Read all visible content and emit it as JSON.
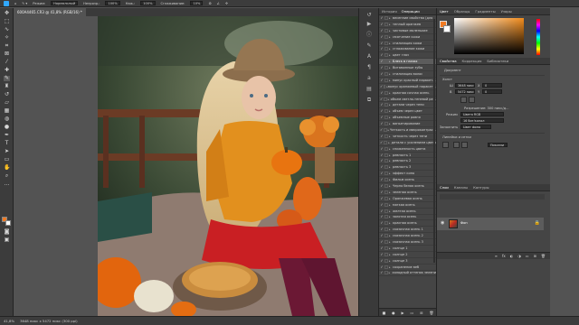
{
  "options_bar": {
    "mode_label": "Режим:",
    "mode_value": "Нормальный",
    "opacity_label": "Непрозр.:",
    "opacity_value": "100%",
    "pressure_label": "Наж.:",
    "pressure_value": "100%",
    "smoothing_label": "Сглаживание:",
    "smoothing_value": "10%"
  },
  "document_tab": {
    "title": "600A4465.CR3 @ 41,8% (RGB/16) *"
  },
  "status_bar": {
    "zoom": "41,8%",
    "dimensions": "3648 пикс x 5472 пикс (300 ppi)"
  },
  "actions_panel": {
    "tabs": [
      "История",
      "Операции"
    ],
    "active_tab": "Операции",
    "items": [
      {
        "label": "весенние свойства (для",
        "checked": true,
        "selected": false
      },
      {
        "label": "теплый оранжев",
        "checked": true,
        "selected": false
      },
      {
        "label": "чистовые маленькие",
        "checked": true,
        "selected": false
      },
      {
        "label": "смягчение кожи",
        "checked": true,
        "selected": false
      },
      {
        "label": "стилизация кожи",
        "checked": true,
        "selected": false
      },
      {
        "label": "сглаживание кожи",
        "checked": true,
        "selected": false
      },
      {
        "label": "цвет глаз",
        "checked": true,
        "selected": false
      },
      {
        "label": "Блеск в глазах",
        "checked": true,
        "selected": true
      },
      {
        "label": "Витаминные зубы",
        "checked": true,
        "selected": false
      },
      {
        "label": "стилизация волос",
        "checked": true,
        "selected": false
      },
      {
        "label": "минус красный паракет...",
        "checked": true,
        "selected": false
      },
      {
        "label": "минус оранжевый паракет...",
        "checked": true,
        "selected": false
      },
      {
        "label": "красная сочная осень",
        "checked": true,
        "selected": false
      },
      {
        "label": "объем светло-теневой ре...",
        "checked": true,
        "selected": false
      },
      {
        "label": "детали через тени",
        "checked": true,
        "selected": false
      },
      {
        "label": "объем через цвет",
        "checked": true,
        "selected": false
      },
      {
        "label": "объемные ровня",
        "checked": true,
        "selected": false
      },
      {
        "label": "виньетирование",
        "checked": true,
        "selected": false
      },
      {
        "label": "Четкость и микроконтрас...",
        "checked": true,
        "selected": false
      },
      {
        "label": "четкость через тени",
        "checked": true,
        "selected": false
      },
      {
        "label": "детали с усилением цвета",
        "checked": true,
        "selected": false
      },
      {
        "label": "сниженность цвета",
        "checked": true,
        "selected": false
      },
      {
        "label": "ревность 1",
        "checked": true,
        "selected": false
      },
      {
        "label": "ревность 2",
        "checked": true,
        "selected": false
      },
      {
        "label": "ревность 3",
        "checked": true,
        "selected": false
      },
      {
        "label": "эффект кино",
        "checked": true,
        "selected": false
      },
      {
        "label": "Фильм осень",
        "checked": true,
        "selected": false
      },
      {
        "label": "Черно белая осень",
        "checked": true,
        "selected": false
      },
      {
        "label": "зеленая осень",
        "checked": true,
        "selected": false
      },
      {
        "label": "Оранжевая осень",
        "checked": true,
        "selected": false
      },
      {
        "label": "мягкая осень",
        "checked": true,
        "selected": false
      },
      {
        "label": "желтая осень",
        "checked": true,
        "selected": false
      },
      {
        "label": "золотая осень",
        "checked": true,
        "selected": false
      },
      {
        "label": "красная осень",
        "checked": true,
        "selected": false
      },
      {
        "label": "сказочная осень 1",
        "checked": true,
        "selected": false
      },
      {
        "label": "сказочная осень 2",
        "checked": true,
        "selected": false
      },
      {
        "label": "сказочная осень 3",
        "checked": true,
        "selected": false
      },
      {
        "label": "солнце 1",
        "checked": true,
        "selected": false
      },
      {
        "label": "солнце 2",
        "checked": true,
        "selected": false
      },
      {
        "label": "солнце 3",
        "checked": true,
        "selected": false
      },
      {
        "label": "сохранение веб",
        "checked": true,
        "selected": false
      },
      {
        "label": "холодный оттенок зелени",
        "checked": true,
        "selected": false
      }
    ]
  },
  "color_panel": {
    "tabs": [
      "Цвет",
      "Образцы",
      "Градиенты",
      "Узоры"
    ],
    "active_tab": "Цвет",
    "foreground": "#f07a22",
    "background": "#ffffff"
  },
  "properties_panel": {
    "tabs": [
      "Свойства",
      "Коррекция",
      "Библиотеки"
    ],
    "active_tab": "Свойства",
    "doc_label": "Документ",
    "canvas_section": "Холст",
    "width_label": "Ш",
    "width_value": "3648 пикс",
    "height_label": "В",
    "height_value": "5472 пикс",
    "x_label": "X",
    "x_value": "0",
    "y_label": "Y",
    "y_value": "0",
    "resolution": "Разрешение: 300 пикс/д...",
    "mode_label": "Режим",
    "mode_value": "Цвета RGB",
    "bits_value": "16 бит/канал",
    "fill_label": "Заполнить",
    "fill_value": "Цвет фона",
    "rulers_section": "Линейки и сетки",
    "units_value": "Пиксели"
  },
  "layers_panel": {
    "tabs": [
      "Слои",
      "Каналы",
      "Контуры"
    ],
    "active_tab": "Слои",
    "layer_name": "Фон"
  },
  "right_strip_icons": [
    "history-icon",
    "actions-icon",
    "info-icon",
    "brush-settings-icon",
    "character-icon",
    "paragraph-icon",
    "glyphs-icon",
    "layer-comps-icon",
    "navigator-icon"
  ]
}
